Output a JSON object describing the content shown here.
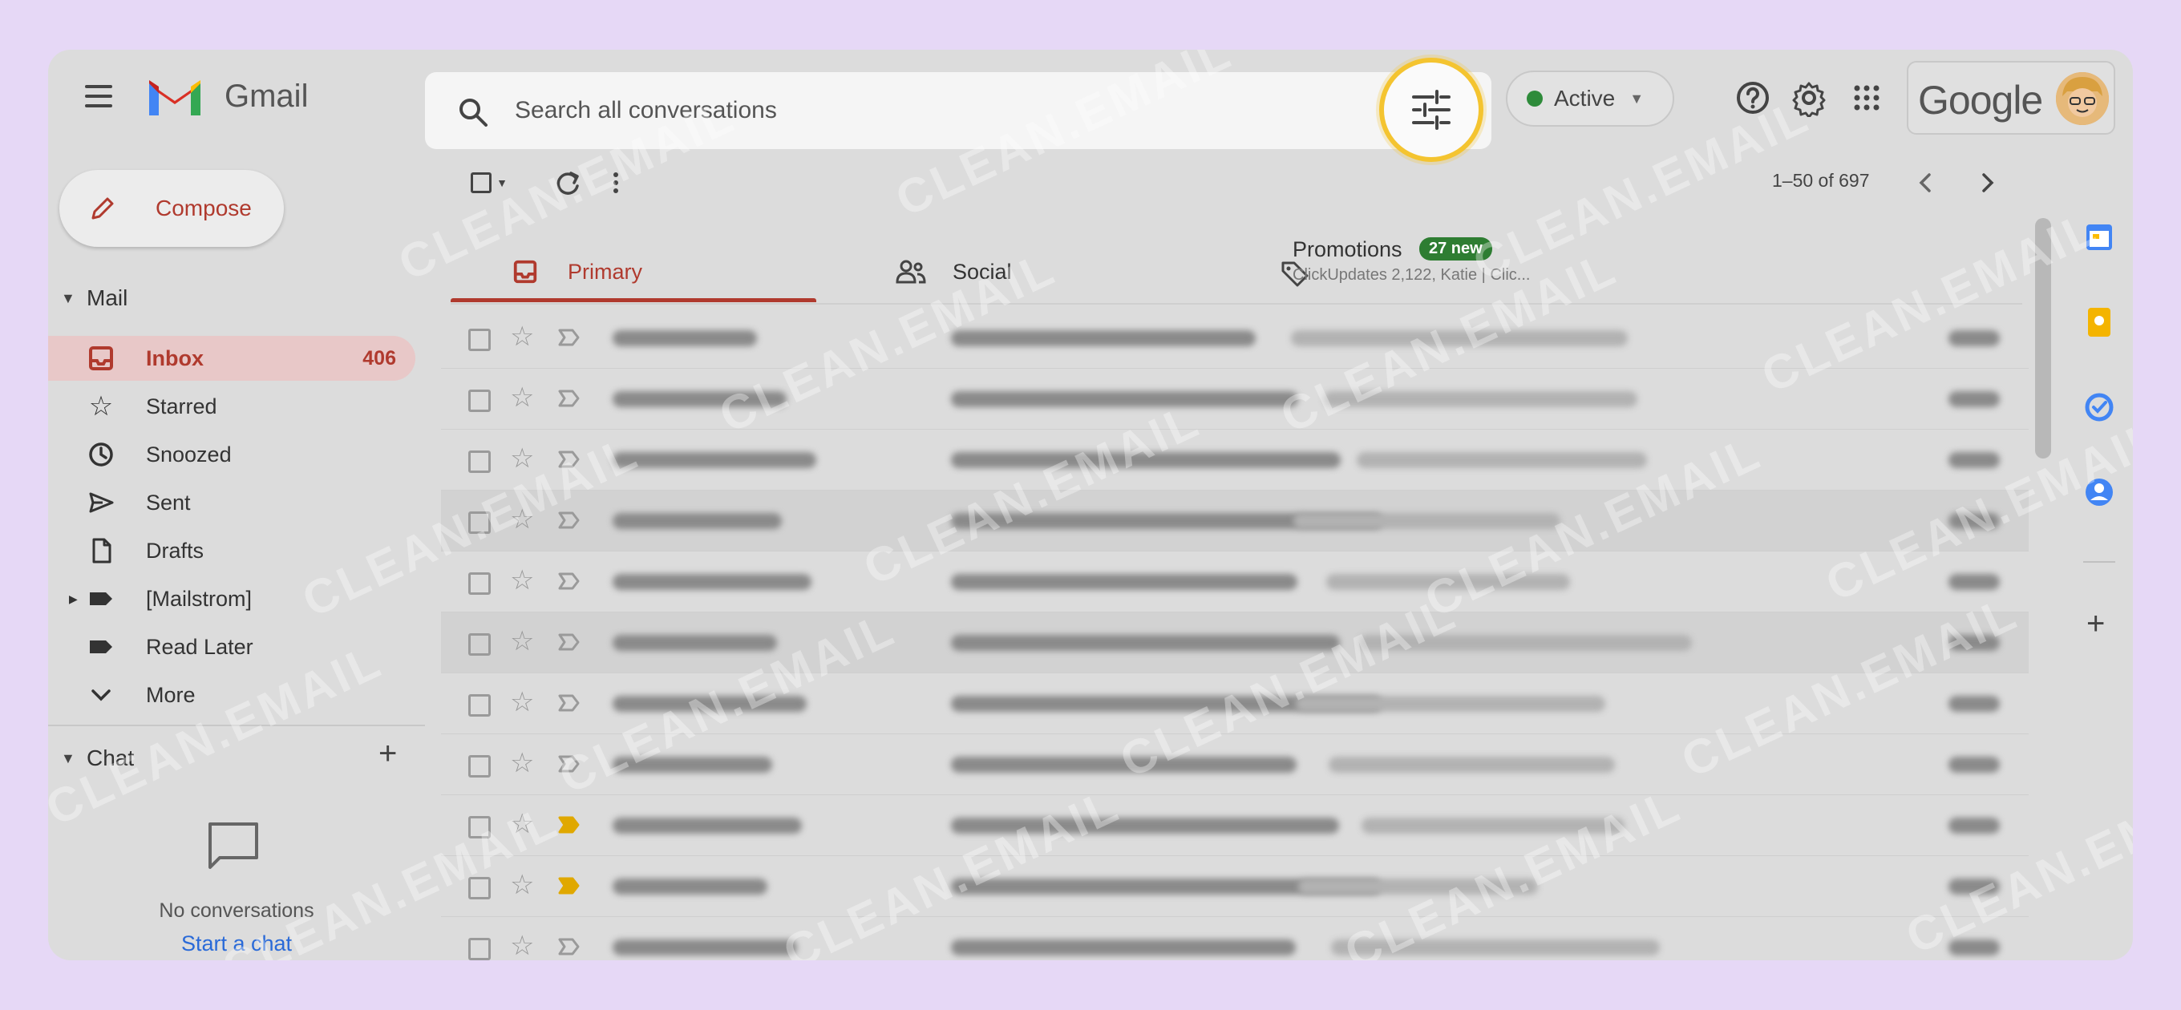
{
  "app": {
    "brand": "Gmail"
  },
  "search": {
    "placeholder": "Search all conversations"
  },
  "status": {
    "label": "Active",
    "color": "#2e8b3a"
  },
  "account": {
    "wordmark": "Google"
  },
  "compose": {
    "label": "Compose"
  },
  "sidebar": {
    "mail_section": "Mail",
    "items": [
      {
        "label": "Inbox",
        "count": "406",
        "icon": "inbox-icon",
        "active": true
      },
      {
        "label": "Starred",
        "icon": "star-icon"
      },
      {
        "label": "Snoozed",
        "icon": "clock-icon"
      },
      {
        "label": "Sent",
        "icon": "send-icon"
      },
      {
        "label": "Drafts",
        "icon": "draft-icon"
      },
      {
        "label": "[Mailstrom]",
        "icon": "label-icon"
      },
      {
        "label": "Read Later",
        "icon": "label-icon"
      },
      {
        "label": "More",
        "icon": "chevron-down-icon"
      }
    ],
    "chat_section": "Chat",
    "chat_empty": "No conversations",
    "chat_link": "Start a chat"
  },
  "toolbar": {
    "pager": "1–50 of 697"
  },
  "tabs": [
    {
      "label": "Primary",
      "icon": "inbox-icon"
    },
    {
      "label": "Social",
      "icon": "people-icon"
    },
    {
      "label": "Promotions",
      "icon": "tag-icon",
      "badge": "27 new",
      "subtitle": "ClickUpdates 2,122, Katie | Clic..."
    }
  ],
  "watermark": "CLEAN.EMAIL",
  "colors": {
    "accent": "#b03a2e",
    "badge": "#2e7d32",
    "highlight": "#f4c430"
  }
}
